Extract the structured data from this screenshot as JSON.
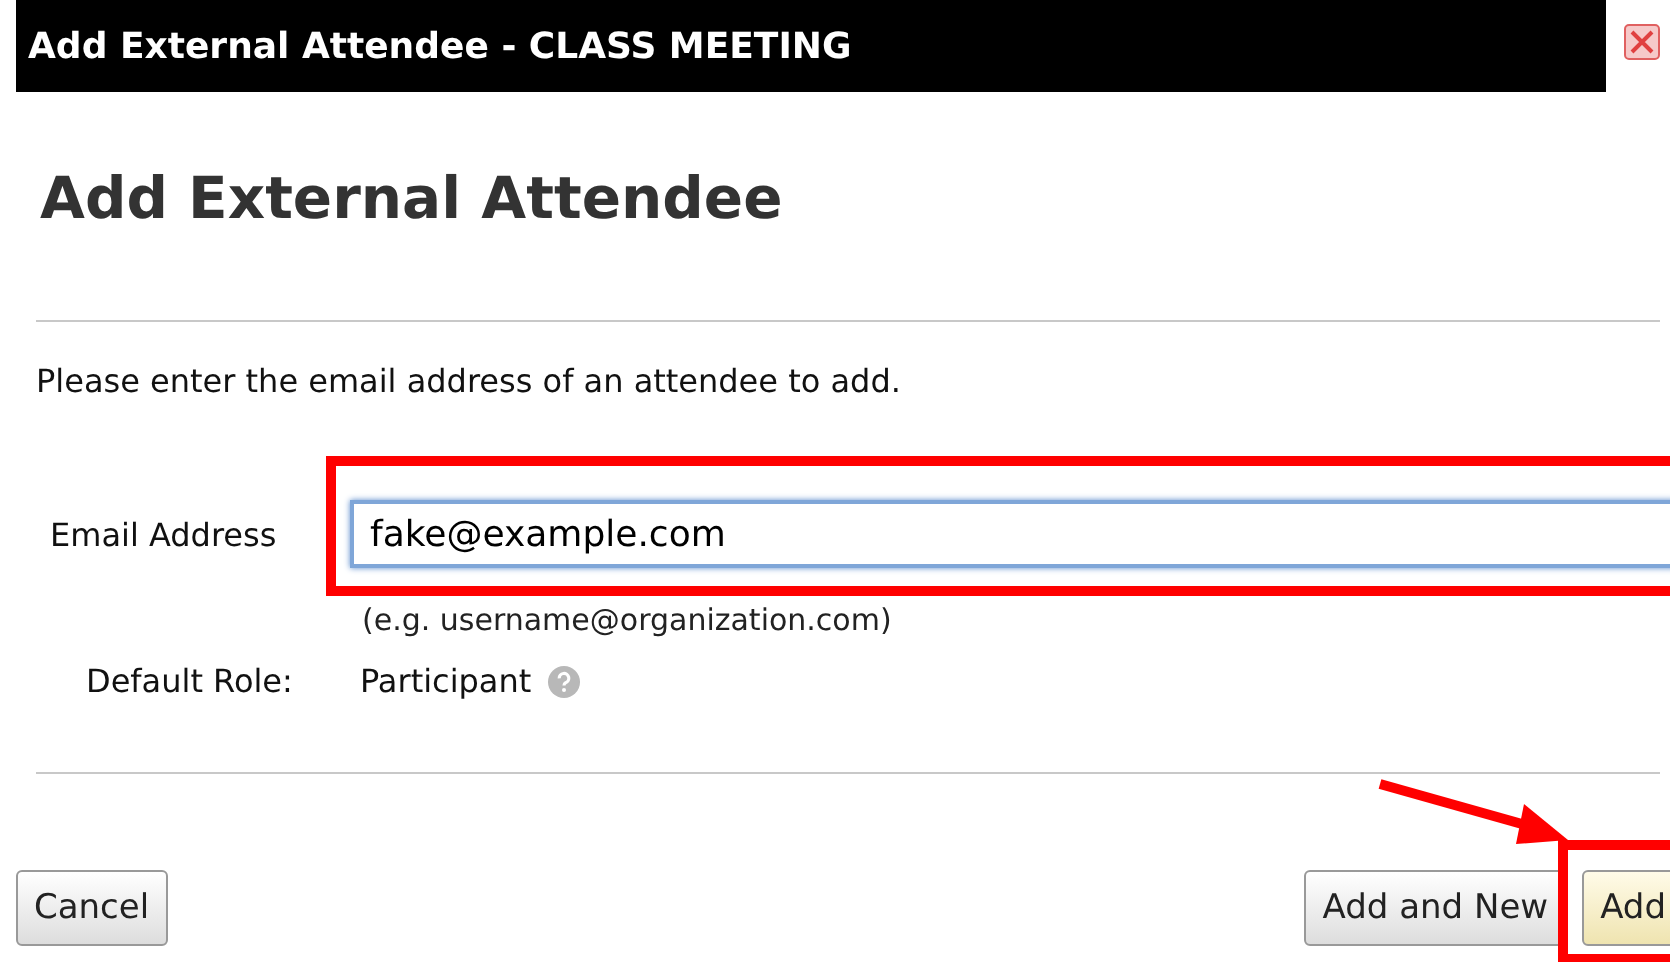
{
  "window": {
    "title": "Add External Attendee - CLASS MEETING"
  },
  "heading": "Add External Attendee",
  "instruction": "Please enter the email address of an attendee to add.",
  "email": {
    "label": "Email Address",
    "value": "fake@example.com",
    "hint": "(e.g. username@organization.com)"
  },
  "role": {
    "label": "Default Role:",
    "value": "Participant"
  },
  "left_buttons": [
    {
      "label": "Cancel",
      "primary": false
    }
  ],
  "right_buttons": [
    {
      "label": "Add and New",
      "primary": false
    },
    {
      "label": "Add",
      "primary": true
    }
  ]
}
